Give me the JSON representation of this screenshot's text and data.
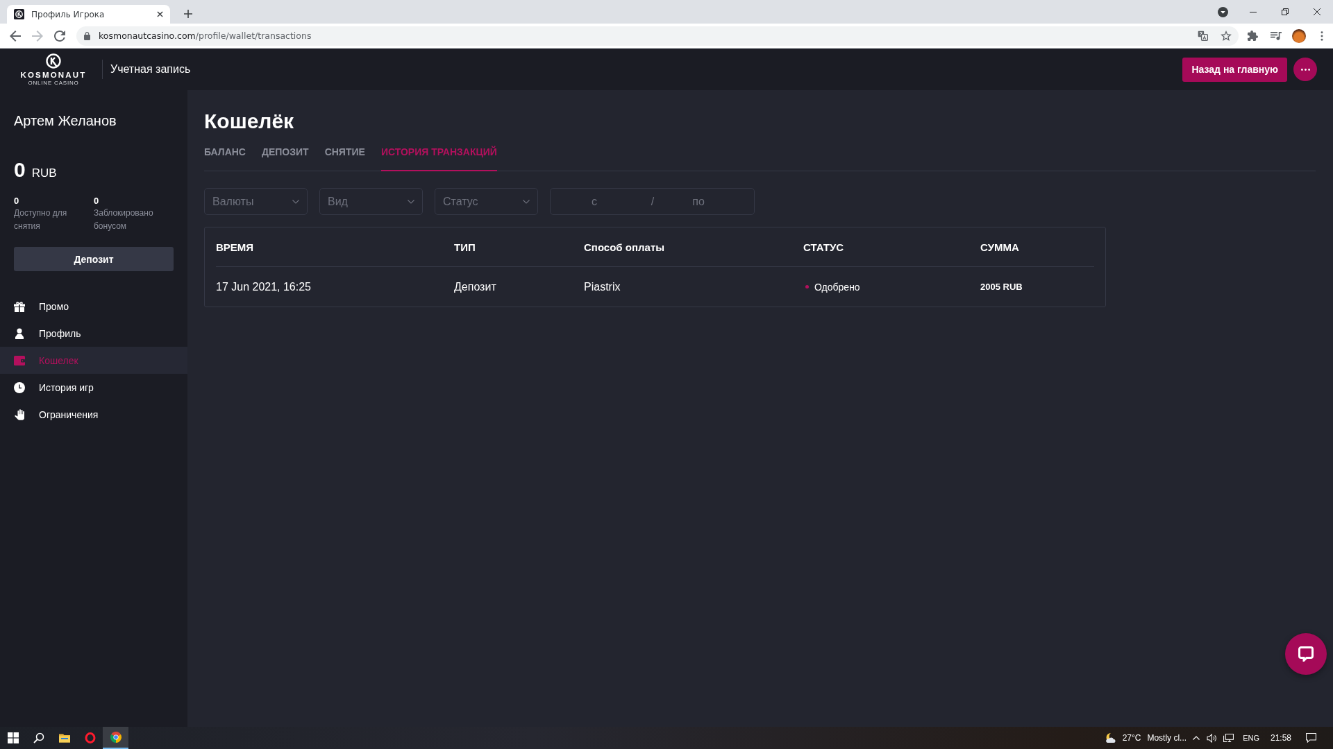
{
  "browser": {
    "tab_title": "Профиль Игрока",
    "nav": [
      {
        "kind": "back",
        "disabled": false
      },
      {
        "kind": "forward",
        "disabled": true
      },
      {
        "kind": "reload",
        "disabled": false
      }
    ],
    "url": {
      "host": "kosmonautcasino.com",
      "path": "/profile/wallet/transactions"
    }
  },
  "header": {
    "logo": {
      "name": "KOSMONAUT",
      "tagline": "ONLINE CASINO"
    },
    "section_title": "Учетная запись",
    "home_button": "Назад на главную"
  },
  "sidebar": {
    "user_name": "Артем Желанов",
    "balance": {
      "amount": "0",
      "currency": "RUB"
    },
    "stats": [
      {
        "value": "0",
        "label": "Доступно для снятия"
      },
      {
        "value": "0",
        "label": "Заблокировано бонусом"
      }
    ],
    "deposit_button": "Депозит",
    "menu": [
      {
        "kind": "gift",
        "label": "Промо",
        "selected": false
      },
      {
        "kind": "user",
        "label": "Профиль",
        "selected": false
      },
      {
        "kind": "wallet",
        "label": "Кошелек",
        "selected": true
      },
      {
        "kind": "clock",
        "label": "История игр",
        "selected": false
      },
      {
        "kind": "hand",
        "label": "Ограничения",
        "selected": false
      }
    ]
  },
  "main": {
    "title": "Кошелёк",
    "tabs": [
      {
        "label": "БАЛАНС",
        "selected": false
      },
      {
        "label": "ДЕПОЗИТ",
        "selected": false
      },
      {
        "label": "СНЯТИЕ",
        "selected": false
      },
      {
        "label": "ИСТОРИЯ ТРАНЗАКЦИЙ",
        "selected": true
      }
    ],
    "filters": [
      {
        "kind": "select",
        "placeholder": "Валюты"
      },
      {
        "kind": "select",
        "placeholder": "Вид"
      },
      {
        "kind": "select",
        "placeholder": "Статус"
      },
      {
        "kind": "date_range",
        "from_placeholder": "с",
        "separator": "/",
        "to_placeholder": "по"
      }
    ],
    "table": {
      "columns": [
        "ВРЕМЯ",
        "ТИП",
        "Способ оплаты",
        "СТАТУС",
        "СУММА"
      ],
      "rows": [
        {
          "time": "17 Jun 2021, 16:25",
          "type": "Депозит",
          "method": "Piastrix",
          "status": {
            "label": "Одобрено",
            "color": "#b3105d"
          },
          "amount": "2005 RUB"
        }
      ]
    }
  },
  "taskbar": {
    "apps": [
      {
        "kind": "start",
        "active": false
      },
      {
        "kind": "search",
        "active": false
      },
      {
        "kind": "folder",
        "active": false
      },
      {
        "kind": "ring",
        "active": false
      },
      {
        "kind": "browser",
        "active": true
      }
    ],
    "tray": {
      "temperature": "27°C",
      "weather": "Mostly cl...",
      "language": "ENG",
      "time": "21:58"
    }
  }
}
